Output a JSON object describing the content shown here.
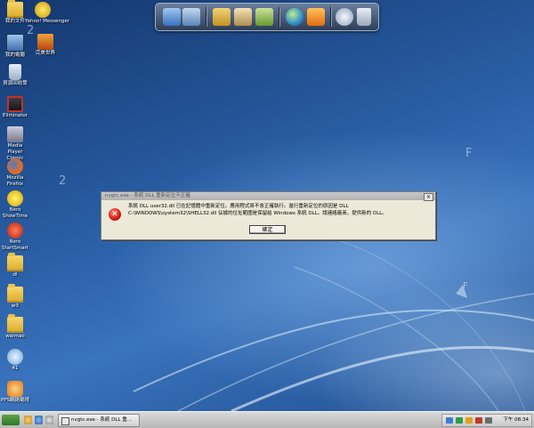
{
  "desktop": {
    "icons": [
      {
        "label": "我的文件"
      },
      {
        "label": "Yahoo! Messenger"
      },
      {
        "label": "我的電腦"
      },
      {
        "label": "完美世界"
      },
      {
        "label": "資源回收筒"
      },
      {
        "label": "Eliminator"
      },
      {
        "label": "Media Player Classic"
      },
      {
        "label": "Mozilla Firefox"
      },
      {
        "label": "Nero ShowTime"
      },
      {
        "label": "Nero StartSmart"
      },
      {
        "label": "dl"
      },
      {
        "label": "w3"
      },
      {
        "label": "waimao"
      },
      {
        "label": "41"
      },
      {
        "label": "PPS網絡電視"
      }
    ],
    "floating_chars": [
      "2",
      "2",
      "F",
      "F"
    ]
  },
  "dock": {
    "items": [
      {
        "icon": "computer-icon",
        "color": "#4a90e2"
      },
      {
        "icon": "folder-icon",
        "color": "#d9b34a"
      },
      {
        "icon": "document-icon",
        "color": "#c9a86a"
      },
      {
        "icon": "folder-pictures-icon",
        "color": "#7db34a"
      },
      {
        "icon": "globe-icon",
        "color": "#3aa2d8"
      },
      {
        "icon": "media-player-icon",
        "color": "#e8892a"
      },
      {
        "icon": "gear-icon",
        "color": "#c7d3e3"
      },
      {
        "icon": "trash-icon",
        "color": "#aab8cc"
      }
    ]
  },
  "dialog": {
    "title": "nvgtc.exe - 系統 DLL 重新定位不正確",
    "close_label": "×",
    "message": "系統 DLL user32.dll 已在記憶體中重新定位。應用程式將不會正確執行。進行重新定位的原因是 DLL C:\\WINDOWS\\system32\\SHELL32.dll 佔據的位址範圍是保留給 Windows 系統 DLL。請連絡廠商，提供新的 DLL。",
    "ok_label": "確定",
    "icon": "error-icon"
  },
  "taskbar": {
    "task_label": "nvgtc.exe - 系統 DLL 重...",
    "clock": "下午 08:34"
  },
  "colors": {
    "desktop_blue": "#24579a",
    "dialog_bg": "#ece9d8",
    "error_red": "#d3170e"
  }
}
